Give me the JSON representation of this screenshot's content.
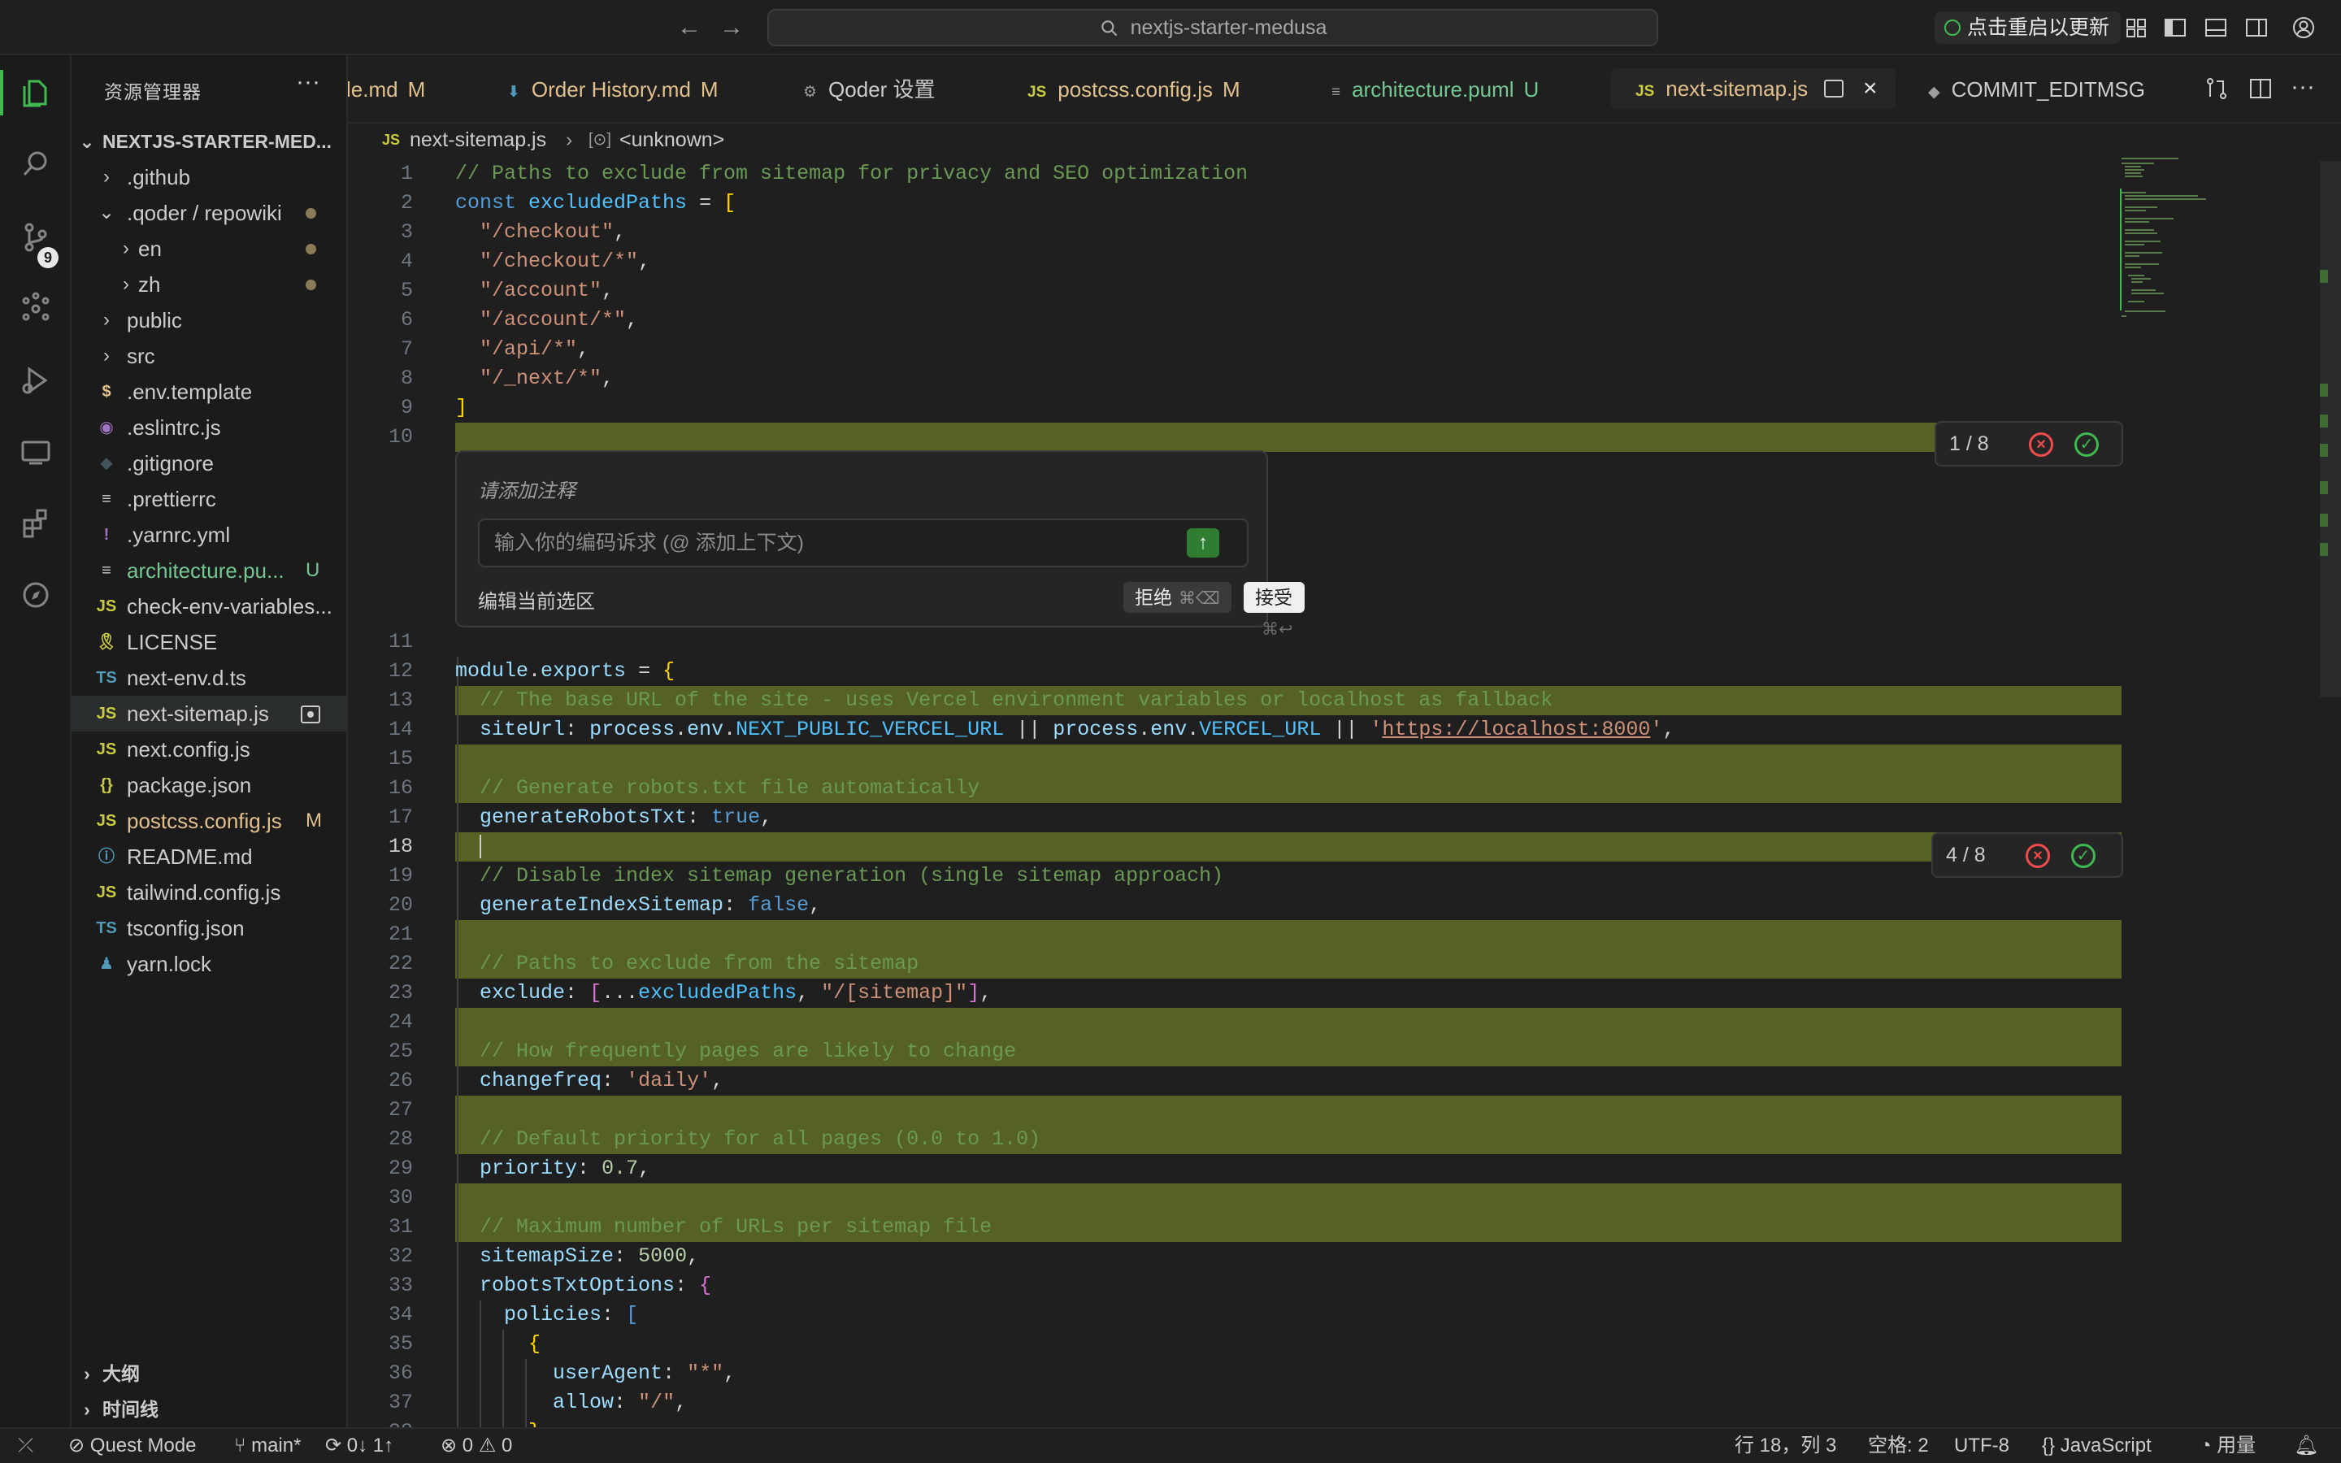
{
  "titlebar": {
    "search_text": "nextjs-starter-medusa",
    "update_label": "点击重启以更新"
  },
  "activity": {
    "source_control_badge": "9"
  },
  "sidebar": {
    "title": "资源管理器",
    "more": "···",
    "root": "NEXTJS-STARTER-MED...",
    "items": [
      {
        "name": ".github",
        "type": "folder",
        "depth": 1
      },
      {
        "name": ".qoder / repowiki",
        "type": "folder-open",
        "depth": 1,
        "dot": true
      },
      {
        "name": "en",
        "type": "folder",
        "depth": 2,
        "dot": true
      },
      {
        "name": "zh",
        "type": "folder",
        "depth": 2,
        "dot": true
      },
      {
        "name": "public",
        "type": "folder",
        "depth": 1
      },
      {
        "name": "src",
        "type": "folder",
        "depth": 1
      },
      {
        "name": ".env.template",
        "icon": "$",
        "color": "#e2c08d"
      },
      {
        "name": ".eslintrc.js",
        "icon": "◉",
        "color": "#a074c4"
      },
      {
        "name": ".gitignore",
        "icon": "◆",
        "color": "#41535b"
      },
      {
        "name": ".prettierrc",
        "icon": "≡",
        "color": "#cccccc"
      },
      {
        "name": ".yarnrc.yml",
        "icon": "!",
        "color": "#a074c4"
      },
      {
        "name": "architecture.pu...",
        "icon": "≡",
        "color": "#cccccc",
        "status": "U",
        "status_color": "#73c991",
        "name_color": "#73c991"
      },
      {
        "name": "check-env-variables...",
        "icon": "JS",
        "color": "#cbcb41"
      },
      {
        "name": "LICENSE",
        "icon": "🎗",
        "color": "#cbcb41"
      },
      {
        "name": "next-env.d.ts",
        "icon": "TS",
        "color": "#519aba"
      },
      {
        "name": "next-sitemap.js",
        "icon": "JS",
        "color": "#cbcb41",
        "selected": true,
        "modified_box": true
      },
      {
        "name": "next.config.js",
        "icon": "JS",
        "color": "#cbcb41"
      },
      {
        "name": "package.json",
        "icon": "{}",
        "color": "#cbcb41"
      },
      {
        "name": "postcss.config.js",
        "icon": "JS",
        "color": "#cbcb41",
        "status": "M",
        "status_color": "#e2c08d",
        "name_color": "#e2c08d"
      },
      {
        "name": "README.md",
        "icon": "ⓘ",
        "color": "#519aba"
      },
      {
        "name": "tailwind.config.js",
        "icon": "JS",
        "color": "#cbcb41"
      },
      {
        "name": "tsconfig.json",
        "icon": "TS",
        "color": "#519aba"
      },
      {
        "name": "yarn.lock",
        "icon": "♟",
        "color": "#519aba"
      }
    ],
    "outline": "大纲",
    "timeline": "时间线"
  },
  "tabs": [
    {
      "label": "le.md",
      "status": "M",
      "icon": "",
      "label_color": "#e2c08d"
    },
    {
      "label": "Order History.md",
      "status": "M",
      "icon": "⬇",
      "label_color": "#e2c08d"
    },
    {
      "label": "Qoder 设置",
      "status": "",
      "icon": "⚙",
      "label_color": "#cccccc"
    },
    {
      "label": "postcss.config.js",
      "status": "M",
      "icon": "JS",
      "label_color": "#e2c08d"
    },
    {
      "label": "architecture.puml",
      "status": "U",
      "icon": "≡",
      "label_color": "#73c991"
    },
    {
      "label": "next-sitemap.js",
      "status": "",
      "icon": "JS",
      "label_color": "#e2c08d",
      "active": true
    },
    {
      "label": "COMMIT_EDITMSG",
      "status": "",
      "icon": "◆",
      "label_color": "#cccccc"
    }
  ],
  "breadcrumb": {
    "file": "next-sitemap.js",
    "symbol": "<unknown>"
  },
  "editor": {
    "current_line": 18,
    "hunk1": {
      "count": "1 / 8"
    },
    "hunk2": {
      "count": "4 / 8"
    },
    "inline_chat": {
      "title": "请添加注释",
      "placeholder": "输入你的编码诉求 (@ 添加上下文)",
      "edit_selection": "编辑当前选区",
      "reject_label": "拒绝",
      "reject_kbd": "⌘⌫",
      "accept_label": "接受",
      "accept_kbd": "⌘↩"
    }
  },
  "statusbar": {
    "quest_mode": "Quest Mode",
    "branch": "main*",
    "sync": "0↓ 1↑",
    "errors": "0",
    "warnings": "0",
    "position": "行 18，列 3",
    "spaces": "空格: 2",
    "encoding": "UTF-8",
    "language": "JavaScript",
    "usage": "用量"
  }
}
